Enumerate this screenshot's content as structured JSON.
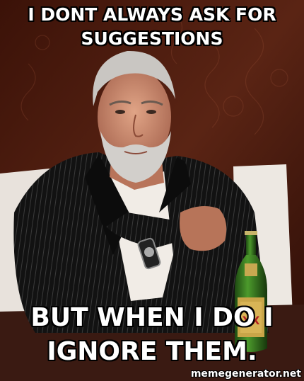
{
  "meme": {
    "top_text": "I DONT ALWAYS ASK FOR\nSUGGESTIONS",
    "bottom_text": "BUT WHEN I DO I\nIGNORE THEM.",
    "watermark": "memegenerator.net"
  },
  "bottle": {
    "label_text": "XX"
  }
}
